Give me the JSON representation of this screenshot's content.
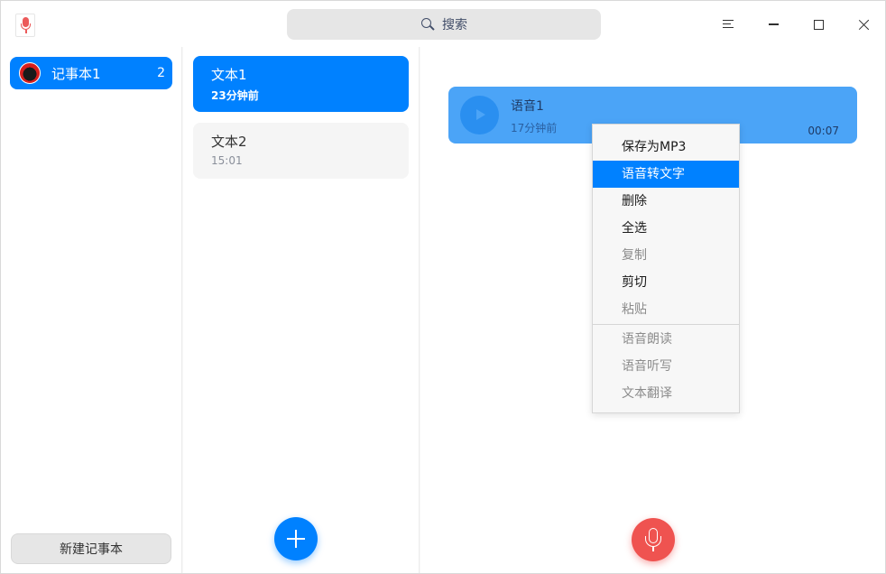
{
  "titlebar": {
    "search_label": "搜索"
  },
  "sidebar": {
    "notebooks": [
      {
        "name": "记事本1",
        "count": "2"
      }
    ],
    "new_notebook_label": "新建记事本"
  },
  "notes": [
    {
      "title": "文本1",
      "time": "23分钟前",
      "active": true
    },
    {
      "title": "文本2",
      "time": "15:01",
      "active": false
    }
  ],
  "editor": {
    "voice": {
      "title": "语音1",
      "time": "17分钟前",
      "duration": "00:07"
    }
  },
  "context_menu": {
    "items": [
      {
        "label": "保存为MP3",
        "state": "enabled"
      },
      {
        "label": "语音转文字",
        "state": "highlighted"
      },
      {
        "label": "删除",
        "state": "enabled"
      },
      {
        "label": "全选",
        "state": "enabled"
      },
      {
        "label": "复制",
        "state": "disabled"
      },
      {
        "label": "剪切",
        "state": "enabled"
      },
      {
        "label": "粘贴",
        "state": "disabled"
      },
      {
        "label": "语音朗读",
        "state": "disabled"
      },
      {
        "label": "语音听写",
        "state": "disabled"
      },
      {
        "label": "文本翻译",
        "state": "disabled"
      }
    ]
  },
  "colors": {
    "accent": "#0081ff",
    "record": "#ef5350",
    "voice_card": "#4ba4f7"
  }
}
